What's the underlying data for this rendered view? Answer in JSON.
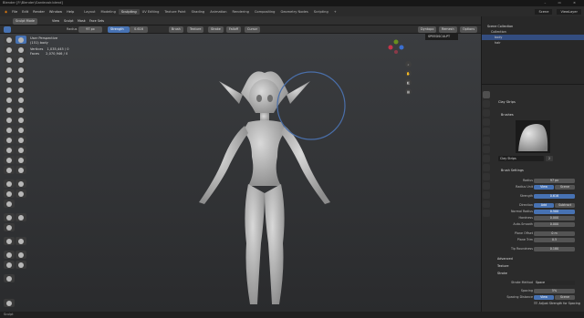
{
  "titlebar": {
    "title": "Blender [F:\\Blender\\Gardevoir.blend]",
    "controls": "– ▭ ×"
  },
  "menu": [
    "File",
    "Edit",
    "Render",
    "Window",
    "Help"
  ],
  "workspaces": [
    "Layout",
    "Modeling",
    "Sculpting",
    "UV Editing",
    "Texture Paint",
    "Shading",
    "Animation",
    "Rendering",
    "Compositing",
    "Geometry Nodes",
    "Scripting"
  ],
  "active_workspace": "Sculpting",
  "scene": "Scene",
  "view_layer": "ViewLayer",
  "header": {
    "mode": "Sculpt Mode",
    "view": "View",
    "sculpt": "Sculpt",
    "mask": "Mask",
    "face_sets": "Face Sets",
    "radius_label": "Radius",
    "radius_value": "97 px",
    "strength_label": "Strength",
    "strength_value": "0.616",
    "brush": "Brush",
    "texture": "Texture",
    "stroke": "Stroke",
    "falloff": "Falloff",
    "cursor": "Cursor",
    "dyntopo": "Dyntopo",
    "remesh": "Remesh",
    "options": "Options"
  },
  "viewport": {
    "perspective": "User Perspective",
    "object": "(151) body",
    "vertices_label": "Vertices",
    "vertices": "1,035,445 / 0",
    "faces_label": "Faces",
    "faces": "2,070,946 / 0",
    "overlay_tag": "SPEEDSCULPT"
  },
  "outliner": {
    "rows": [
      "Scene Collection",
      "Collection",
      "body",
      "hair"
    ]
  },
  "props": {
    "brush_name": "Clay Strips",
    "brushes_label": "Brushes",
    "brush_field": "Clay Strips",
    "brush_users": "2",
    "settings_header": "Brush Settings",
    "rows": [
      {
        "label": "Radius",
        "value": "97 px"
      },
      {
        "label": "Radius Unit",
        "value": "View",
        "value2": "Scene"
      },
      {
        "label": "Strength",
        "value": "0.616"
      },
      {
        "label": "Direction",
        "value": "Add",
        "value2": "Subtract"
      },
      {
        "label": "Normal Radius",
        "value": "0.500"
      },
      {
        "label": "Hardness",
        "value": "0.000"
      },
      {
        "label": "Auto-Smooth",
        "value": "0.000"
      },
      {
        "label": "Plane Offset",
        "value": "0 m"
      },
      {
        "label": "Plane Trim",
        "value": "0.5"
      },
      {
        "label": "Tip Roundness",
        "value": "0.180"
      }
    ],
    "advanced": "Advanced",
    "texture": "Texture",
    "stroke": "Stroke",
    "stroke_method_label": "Stroke Method",
    "stroke_method": "Space",
    "spacing_label": "Spacing",
    "spacing": "5%",
    "spacing_distance_label": "Spacing Distance",
    "spacing_view": "View",
    "spacing_scene": "Scene",
    "adjust_strength": "Adjust Strength for Spacing"
  },
  "status": "Sculpt"
}
